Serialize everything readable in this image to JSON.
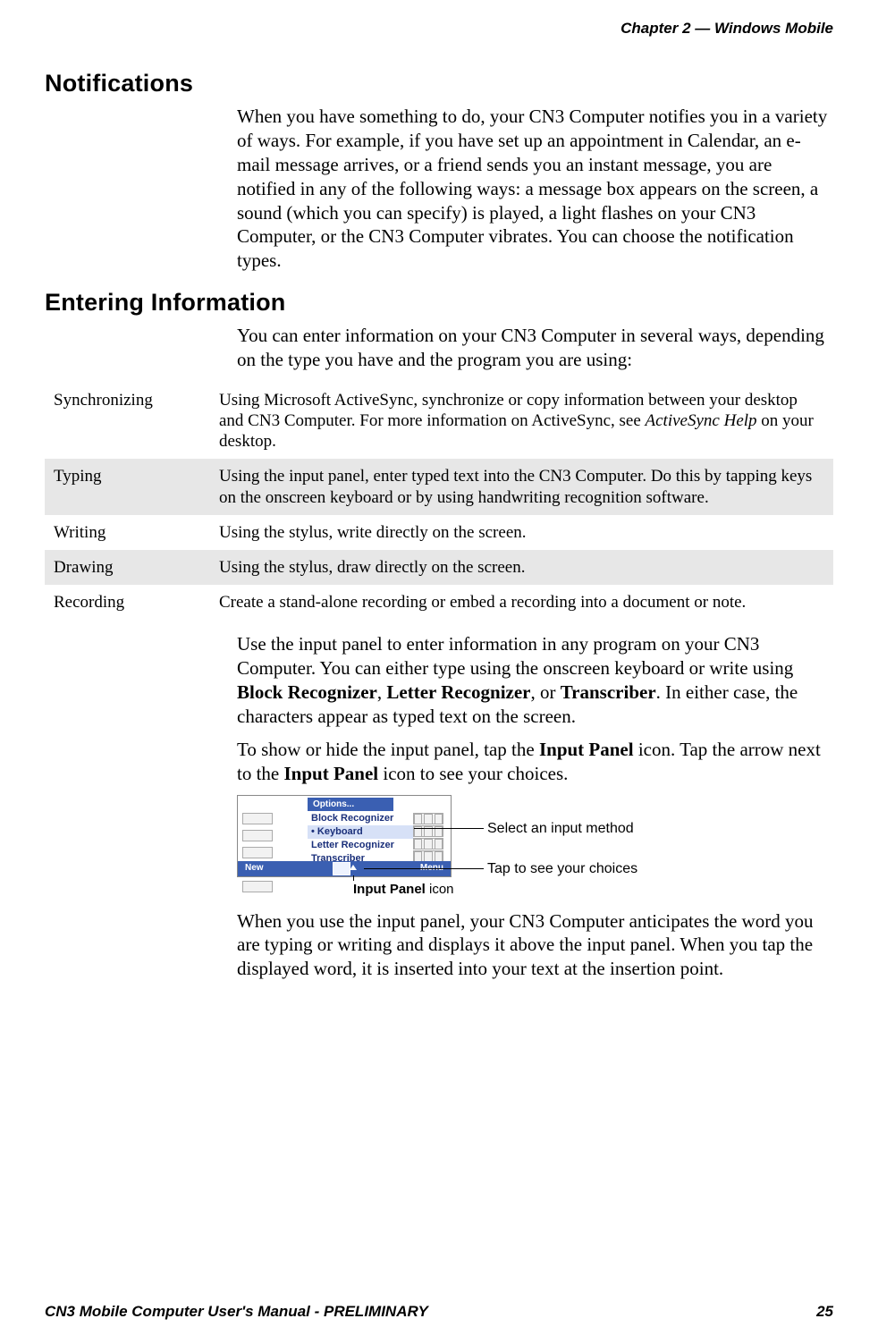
{
  "running_header": "Chapter 2 —  Windows Mobile",
  "sections": {
    "notifications": {
      "heading": "Notifications",
      "body": "When you have something to do, your CN3 Computer notifies you in a variety of ways. For example, if you have set up an appointment in Calendar, an e-mail message arrives, or a friend sends you an instant message, you are notified in any of the following ways: a message box appears on the screen, a sound (which you can specify) is played, a light flashes on your CN3 Computer, or the CN3 Computer vibrates. You can choose the notification types."
    },
    "entering": {
      "heading": "Entering Information",
      "intro": "You can enter information on your CN3 Computer in several ways, depending on the type you have and the program you are using:",
      "table": [
        {
          "term": "Synchronizing",
          "desc_pre": "Using Microsoft ActiveSync, synchronize or copy information between your desktop and CN3 Computer. For more information on ActiveSync, see ",
          "desc_ital": "ActiveSync Help",
          "desc_post": " on your desktop."
        },
        {
          "term": "Typing",
          "desc": "Using the input panel, enter typed text into the CN3 Computer. Do this by tapping keys on the onscreen keyboard or by using handwriting recognition software."
        },
        {
          "term": "Writing",
          "desc": "Using the stylus, write directly on the screen."
        },
        {
          "term": "Drawing",
          "desc": "Using the stylus, draw directly on the screen."
        },
        {
          "term": "Recording",
          "desc": "Create a stand-alone recording or embed a recording into a document or note."
        }
      ],
      "para2_pre": "Use the input panel to enter information in any program on your CN3 Computer. You can either type using the onscreen keyboard or write using ",
      "para2_b1": "Block Recognizer",
      "para2_mid1": ", ",
      "para2_b2": "Letter Recognizer",
      "para2_mid2": ", or ",
      "para2_b3": "Transcriber",
      "para2_post": ". In either case, the characters appear as typed text on the screen.",
      "para3_pre": "To show or hide the input panel, tap the ",
      "para3_b1": "Input Panel",
      "para3_mid": " icon. Tap the arrow next to the ",
      "para3_b2": "Input Panel",
      "para3_post": " icon to see your choices.",
      "figure": {
        "options_label": "Options...",
        "menu_items": [
          "Block Recognizer",
          "Keyboard",
          "Letter Recognizer",
          "Transcriber"
        ],
        "selected_index": 1,
        "bottom_left": "New",
        "bottom_right": "Menu",
        "callout_select": "Select an input method",
        "callout_tap": "Tap to see your choices",
        "caption_bold": "Input Panel",
        "caption_rest": " icon"
      },
      "para4": "When you use the input panel, your CN3 Computer anticipates the word you are typing or writing and displays it above the input panel. When you tap the displayed word, it is inserted into your text at the insertion point."
    }
  },
  "footer": {
    "left": "CN3 Mobile Computer User's Manual - PRELIMINARY",
    "right": "25"
  }
}
